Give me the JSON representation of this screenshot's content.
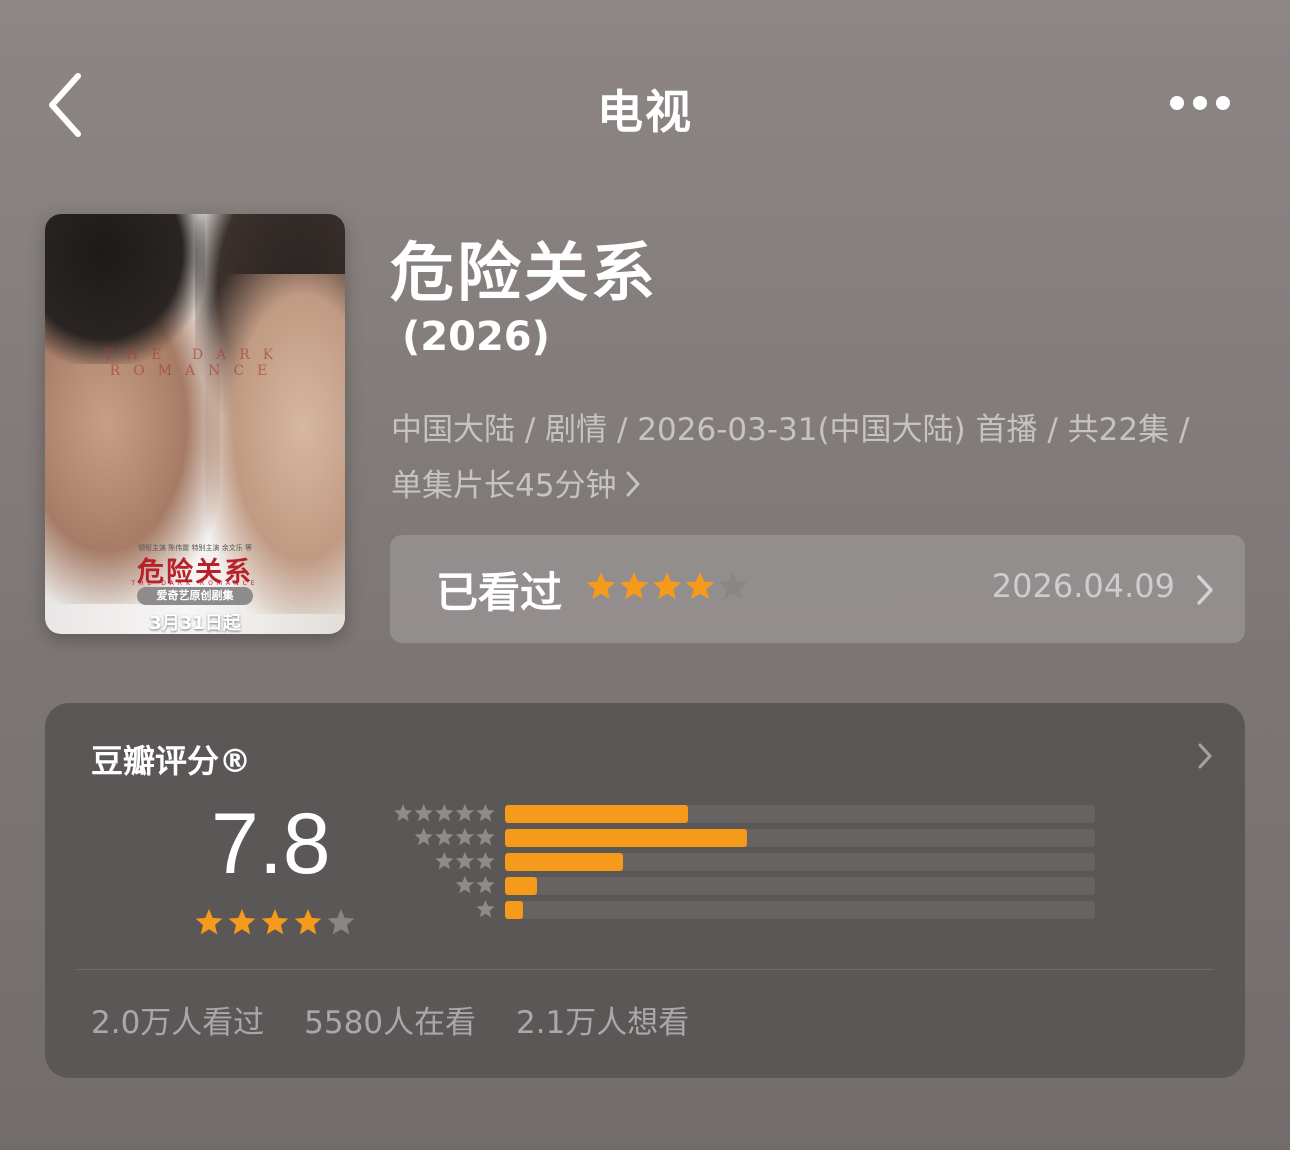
{
  "nav": {
    "title": "电视",
    "back_icon": "chevron-left-icon",
    "more_icon": "more-horizontal-icon"
  },
  "poster": {
    "title": "危险关系",
    "english_title": "THE DARK ROMANCE",
    "subtitle": "THE DARK ROMANCE",
    "badge": "爱奇艺原创剧集",
    "date": "3月31日起",
    "credits": "领衔主演 陈伟霆  特别主演 余文乐 等"
  },
  "show": {
    "title": "危险关系",
    "year": "(2026)",
    "meta_line1": "中国大陆 / 剧情 / 2026-03-31(中国大陆) 首播 / 共22集 /",
    "meta_line2": "单集片长45分钟"
  },
  "watched": {
    "label": "已看过",
    "user_rating": 4,
    "max_rating": 5,
    "date": "2026.04.09"
  },
  "rating_card": {
    "title": "豆瓣评分®",
    "score": "7.8",
    "score_stars": 4,
    "distribution": [
      {
        "stars": 5,
        "fraction": 0.31
      },
      {
        "stars": 4,
        "fraction": 0.41
      },
      {
        "stars": 3,
        "fraction": 0.2
      },
      {
        "stars": 2,
        "fraction": 0.055
      },
      {
        "stars": 1,
        "fraction": 0.03
      }
    ],
    "stats": {
      "watched": "2.0万人看过",
      "watching": "5580人在看",
      "want": "2.1万人想看"
    }
  },
  "colors": {
    "accent_star": "#f59a1b",
    "empty_star": "#8a8685",
    "dist_star": "#8f8b8a"
  }
}
